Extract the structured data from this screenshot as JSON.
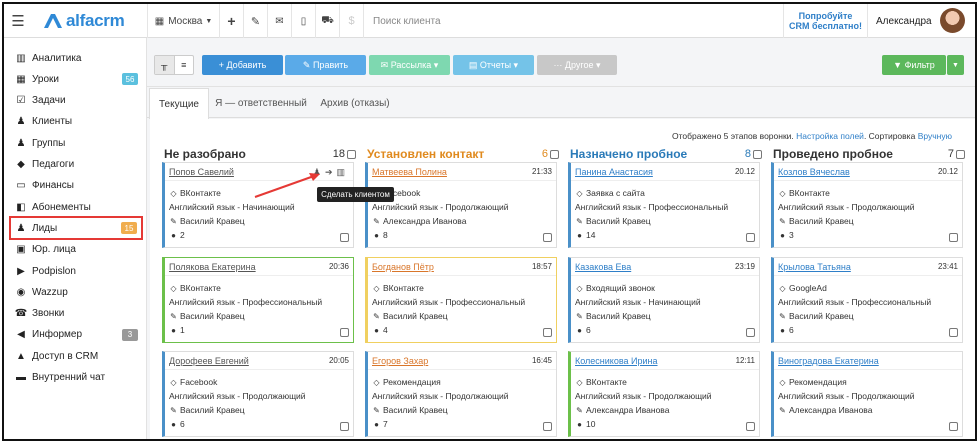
{
  "topbar": {
    "brand": "alfacrm",
    "city": "Москва",
    "search_placeholder": "Поиск клиента",
    "promo_line1": "Попробуйте",
    "promo_line2": "CRM бесплатно!",
    "user_name": "Александра",
    "icons": [
      "menu-icon",
      "plus-icon",
      "wrench-icon",
      "mail-icon",
      "phone-icon",
      "cart-icon",
      "dollar-icon"
    ]
  },
  "sidebar": {
    "items": [
      {
        "label": "Аналитика",
        "icon": "book-icon",
        "badge": ""
      },
      {
        "label": "Уроки",
        "icon": "calendar-icon",
        "badge": "56"
      },
      {
        "label": "Задачи",
        "icon": "checklist-icon",
        "badge": ""
      },
      {
        "label": "Клиенты",
        "icon": "user-icon",
        "badge": ""
      },
      {
        "label": "Группы",
        "icon": "users-icon",
        "badge": ""
      },
      {
        "label": "Педагоги",
        "icon": "graduation-cap-icon",
        "badge": ""
      },
      {
        "label": "Финансы",
        "icon": "money-icon",
        "badge": ""
      },
      {
        "label": "Абонементы",
        "icon": "ticket-icon",
        "badge": ""
      },
      {
        "label": "Лиды",
        "icon": "user-plus-icon",
        "badge": "15"
      },
      {
        "label": "Юр. лица",
        "icon": "briefcase-icon",
        "badge": ""
      },
      {
        "label": "Podpislon",
        "icon": "podpislon-icon",
        "badge": ""
      },
      {
        "label": "Wazzup",
        "icon": "whatsapp-icon",
        "badge": ""
      },
      {
        "label": "Звонки",
        "icon": "phone-icon",
        "badge": ""
      },
      {
        "label": "Информер",
        "icon": "megaphone-icon",
        "badge": "3"
      },
      {
        "label": "Доступ в CRM",
        "icon": "lock-icon",
        "badge": ""
      },
      {
        "label": "Внутренний чат",
        "icon": "chat-icon",
        "badge": ""
      }
    ],
    "colors": {
      "badge_blue": "#5bc0de",
      "badge_orange": "#f0ad4e",
      "badge_gray": "#999999",
      "highlight": "#e53935"
    }
  },
  "toolbar": {
    "add": "+ Добавить",
    "edit": "✎ Править",
    "mailing": "✉ Рассылка ▾",
    "reports": "▤ Отчеты ▾",
    "other": "··· Другое ▾",
    "filter": "▼ Фильтр"
  },
  "tabs": [
    "Текущие",
    "Я — ответственный",
    "Архив (отказы)"
  ],
  "info": {
    "prefix": "Отображено 5 этапов воронки. ",
    "fields_link": "Настройка полей",
    "middle": ". Сортировка ",
    "sort_link": "Вручную"
  },
  "tooltip": "Сделать клиентом",
  "columns": [
    {
      "title": "Не разобрано",
      "count": "18",
      "color": "#333333",
      "cards": [
        {
          "name": "Попов Савелий",
          "time": "",
          "source": "ВКонтакте",
          "course": "Английский язык - Начинающий",
          "teacher": "Василий Кравец",
          "comments": "2",
          "border": "#4a90c8"
        },
        {
          "name": "Полякова Екатерина",
          "time": "20:36",
          "source": "ВКонтакте",
          "course": "Английский язык - Профессиональный",
          "teacher": "Василий Кравец",
          "comments": "1",
          "border": "#6cc04a"
        },
        {
          "name": "Дорофеев Евгений",
          "time": "20:05",
          "source": "Facebook",
          "course": "Английский язык - Продолжающий",
          "teacher": "Василий Кравец",
          "comments": "6",
          "border": "#4a90c8"
        }
      ]
    },
    {
      "title": "Установлен контакт",
      "count": "6",
      "color": "#e08a1e",
      "cards": [
        {
          "name": "Матвеева Полина",
          "time": "21:33",
          "source": "Facebook",
          "course": "Английский язык - Продолжающий",
          "teacher": "Александра Иванова",
          "comments": "8",
          "border": "#4a90c8"
        },
        {
          "name": "Богданов Пётр",
          "time": "18:57",
          "source": "ВКонтакте",
          "course": "Английский язык - Профессиональный",
          "teacher": "Василий Кравец",
          "comments": "4",
          "border": "#f0d060"
        },
        {
          "name": "Егоров Захар",
          "time": "16:45",
          "source": "Рекомендация",
          "course": "Английский язык - Продолжающий",
          "teacher": "Василий Кравец",
          "comments": "7",
          "border": "#4a90c8"
        }
      ]
    },
    {
      "title": "Назначено пробное",
      "count": "8",
      "color": "#2a7ab8",
      "cards": [
        {
          "name": "Панина Анастасия",
          "time": "20.12",
          "source": "Заявка с сайта",
          "course": "Английский язык - Профессиональный",
          "teacher": "Василий Кравец",
          "comments": "14",
          "border": "#4a90c8"
        },
        {
          "name": "Казакова Ева",
          "time": "23:19",
          "source": "Входящий звонок",
          "course": "Английский язык - Начинающий",
          "teacher": "Василий Кравец",
          "comments": "6",
          "border": "#4a90c8"
        },
        {
          "name": "Колесникова Ирина",
          "time": "12:11",
          "source": "ВКонтакте",
          "course": "Английский язык - Продолжающий",
          "teacher": "Александра Иванова",
          "comments": "10",
          "border": "#6cc04a"
        }
      ]
    },
    {
      "title": "Проведено пробное",
      "count": "7",
      "color": "#333333",
      "cards": [
        {
          "name": "Козлов Вячеслав",
          "time": "20.12",
          "source": "ВКонтакте",
          "course": "Английский язык - Продолжающий",
          "teacher": "Василий Кравец",
          "comments": "3",
          "border": "#4a90c8"
        },
        {
          "name": "Крылова Татьяна",
          "time": "23:41",
          "source": "GoogleAd",
          "course": "Английский язык - Профессиональный",
          "teacher": "Василий Кравец",
          "comments": "6",
          "border": "#4a90c8"
        },
        {
          "name": "Виноградова Екатерина",
          "time": "",
          "source": "Рекомендация",
          "course": "Английский язык - Продолжающий",
          "teacher": "Александра Иванова",
          "comments": "",
          "border": "#4a90c8"
        }
      ]
    }
  ]
}
